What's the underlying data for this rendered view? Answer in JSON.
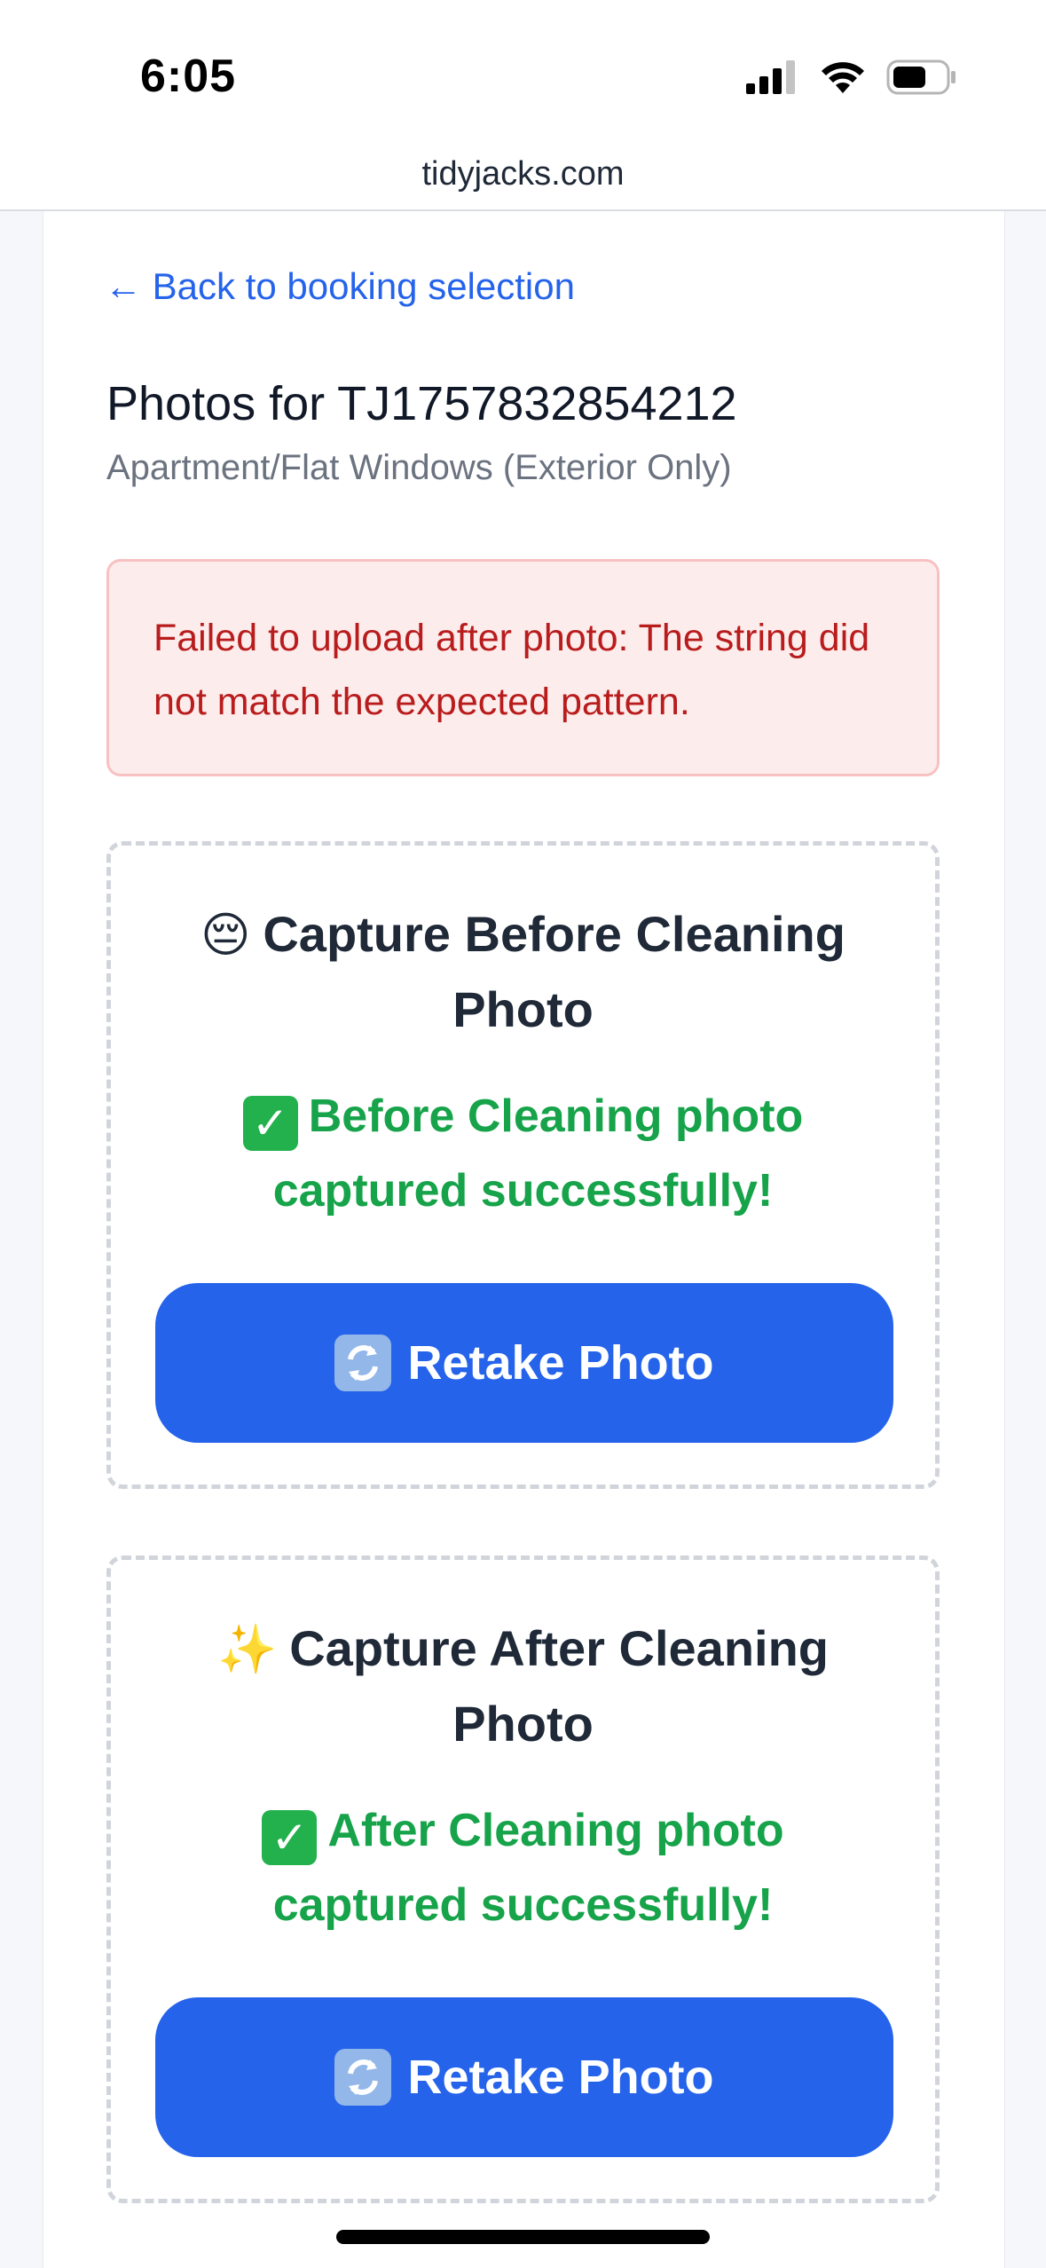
{
  "status_bar": {
    "time": "6:05"
  },
  "browser": {
    "url": "tidyjacks.com"
  },
  "nav": {
    "back_link": "← Back to booking selection"
  },
  "header": {
    "title": "Photos for TJ1757832854212",
    "subtitle": "Apartment/Flat Windows (Exterior Only)"
  },
  "error": {
    "message": "Failed to upload after photo: The string did not match the expected pattern."
  },
  "cards": [
    {
      "emoji": "😔",
      "heading": "Capture Before Cleaning Photo",
      "success": "Before Cleaning photo captured successfully!",
      "button_label": "Retake Photo"
    },
    {
      "emoji": "✨",
      "heading": "Capture After Cleaning Photo",
      "success": "After Cleaning photo captured successfully!",
      "button_label": "Retake Photo"
    }
  ],
  "colors": {
    "accent": "#2563eb",
    "success": "#16a34a",
    "error_text": "#b91c1c",
    "error_bg": "#fdecec"
  }
}
